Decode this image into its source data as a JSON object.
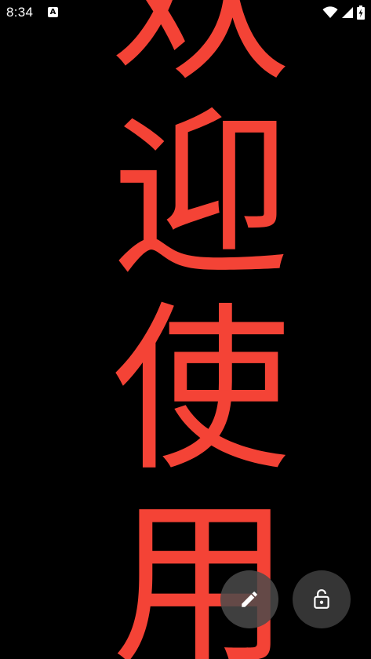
{
  "status_bar": {
    "time": "8:34",
    "notification_icon_letter": "A",
    "icons": [
      "wifi-icon",
      "cell-signal-icon",
      "battery-icon"
    ]
  },
  "banner": {
    "text": "欢迎使用",
    "color": "#f44336",
    "background": "#000000"
  },
  "actions": {
    "edit_icon": "pencil-icon",
    "lock_icon": "unlock-icon"
  }
}
